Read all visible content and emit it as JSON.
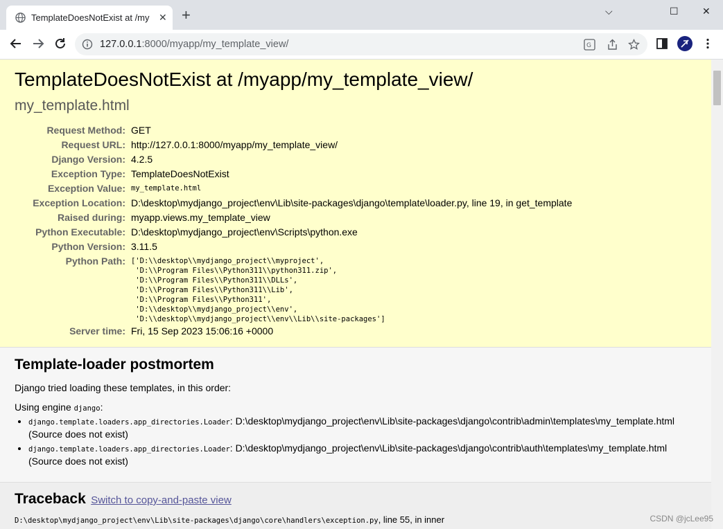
{
  "tab": {
    "title": "TemplateDoesNotExist at /my",
    "close": "✕"
  },
  "window": {
    "minimize": "⌵",
    "restore": "☐",
    "close": "✕",
    "newtab": "+"
  },
  "address": {
    "host": "127.0.0.1",
    "path": ":8000/myapp/my_template_view/"
  },
  "error": {
    "title": "TemplateDoesNotExist at /myapp/my_template_view/",
    "subtitle": "my_template.html",
    "rows": [
      {
        "label": "Request Method:",
        "value": "GET"
      },
      {
        "label": "Request URL:",
        "value": "http://127.0.0.1:8000/myapp/my_template_view/"
      },
      {
        "label": "Django Version:",
        "value": "4.2.5"
      },
      {
        "label": "Exception Type:",
        "value": "TemplateDoesNotExist"
      },
      {
        "label": "Exception Value:",
        "value": "my_template.html"
      },
      {
        "label": "Exception Location:",
        "value": "D:\\desktop\\mydjango_project\\env\\Lib\\site-packages\\django\\template\\loader.py, line 19, in get_template"
      },
      {
        "label": "Raised during:",
        "value": "myapp.views.my_template_view"
      },
      {
        "label": "Python Executable:",
        "value": "D:\\desktop\\mydjango_project\\env\\Scripts\\python.exe"
      },
      {
        "label": "Python Version:",
        "value": "3.11.5"
      },
      {
        "label": "Python Path:",
        "value": "['D:\\\\desktop\\\\mydjango_project\\\\myproject',\n 'D:\\\\Program Files\\\\Python311\\\\python311.zip',\n 'D:\\\\Program Files\\\\Python311\\\\DLLs',\n 'D:\\\\Program Files\\\\Python311\\\\Lib',\n 'D:\\\\Program Files\\\\Python311',\n 'D:\\\\desktop\\\\mydjango_project\\\\env',\n 'D:\\\\desktop\\\\mydjango_project\\\\env\\\\Lib\\\\site-packages']"
      },
      {
        "label": "Server time:",
        "value": "Fri, 15 Sep 2023 15:06:16 +0000"
      }
    ]
  },
  "postmortem": {
    "title": "Template-loader postmortem",
    "intro": "Django tried loading these templates, in this order:",
    "engine_prefix": "Using engine ",
    "engine": "django",
    "engine_suffix": ":",
    "items": [
      {
        "loader": "django.template.loaders.app_directories.Loader",
        "path": ": D:\\desktop\\mydjango_project\\env\\Lib\\site-packages\\django\\contrib\\admin\\templates\\my_template.html",
        "status": "(Source does not exist)"
      },
      {
        "loader": "django.template.loaders.app_directories.Loader",
        "path": ": D:\\desktop\\mydjango_project\\env\\Lib\\site-packages\\django\\contrib\\auth\\templates\\my_template.html",
        "status": "(Source does not exist)"
      }
    ]
  },
  "traceback": {
    "title": "Traceback",
    "switch_link": "Switch to copy-and-paste view",
    "frame_file": "D:\\desktop\\mydjango_project\\env\\Lib\\site-packages\\django\\core\\handlers\\exception.py",
    "frame_loc": ", line 55, in inner"
  },
  "watermark": "CSDN @jcLee95"
}
